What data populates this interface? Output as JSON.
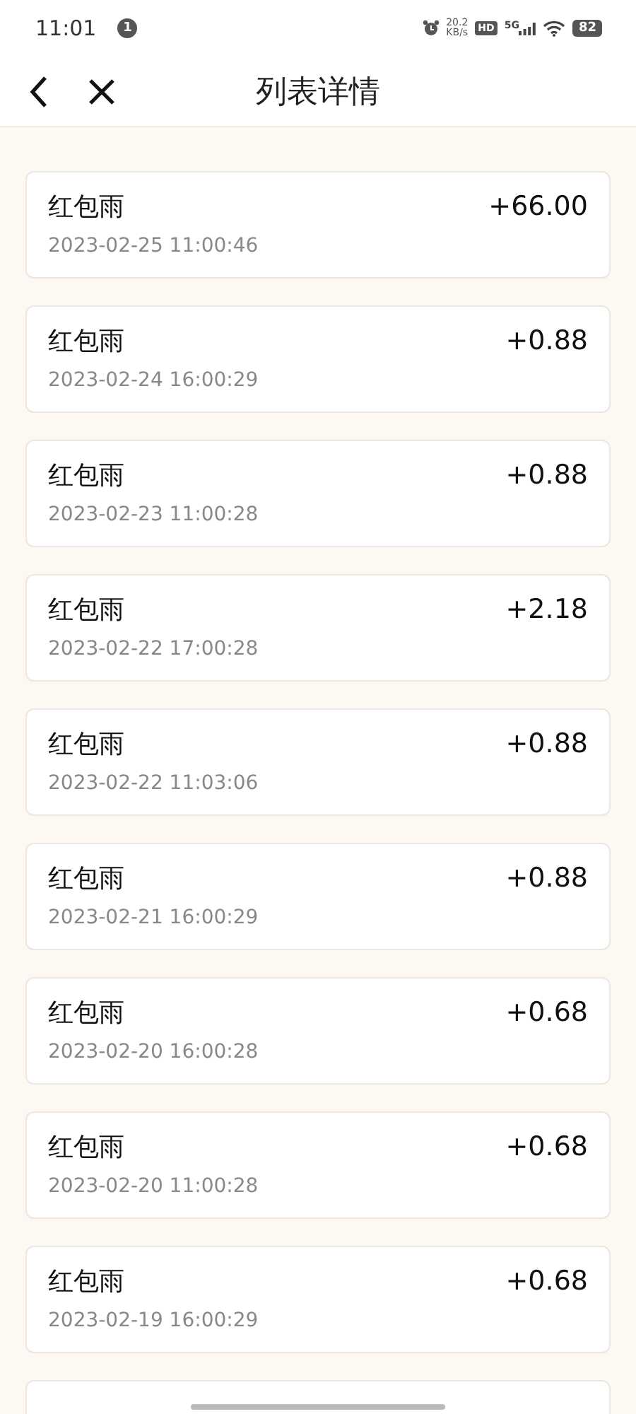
{
  "status_bar": {
    "time": "11:01",
    "notification_count": "1",
    "net_speed": "20.2",
    "net_unit": "KB/s",
    "hd": "HD",
    "network": "5G",
    "battery": "82"
  },
  "nav": {
    "title": "列表详情"
  },
  "records": [
    {
      "title": "红包雨",
      "time": "2023-02-25 11:00:46",
      "amount": "+66.00"
    },
    {
      "title": "红包雨",
      "time": "2023-02-24 16:00:29",
      "amount": "+0.88"
    },
    {
      "title": "红包雨",
      "time": "2023-02-23 11:00:28",
      "amount": "+0.88"
    },
    {
      "title": "红包雨",
      "time": "2023-02-22 17:00:28",
      "amount": "+2.18"
    },
    {
      "title": "红包雨",
      "time": "2023-02-22 11:03:06",
      "amount": "+0.88"
    },
    {
      "title": "红包雨",
      "time": "2023-02-21 16:00:29",
      "amount": "+0.88"
    },
    {
      "title": "红包雨",
      "time": "2023-02-20 16:00:28",
      "amount": "+0.68"
    },
    {
      "title": "红包雨",
      "time": "2023-02-20 11:00:28",
      "amount": "+0.68"
    },
    {
      "title": "红包雨",
      "time": "2023-02-19 16:00:29",
      "amount": "+0.68"
    }
  ]
}
